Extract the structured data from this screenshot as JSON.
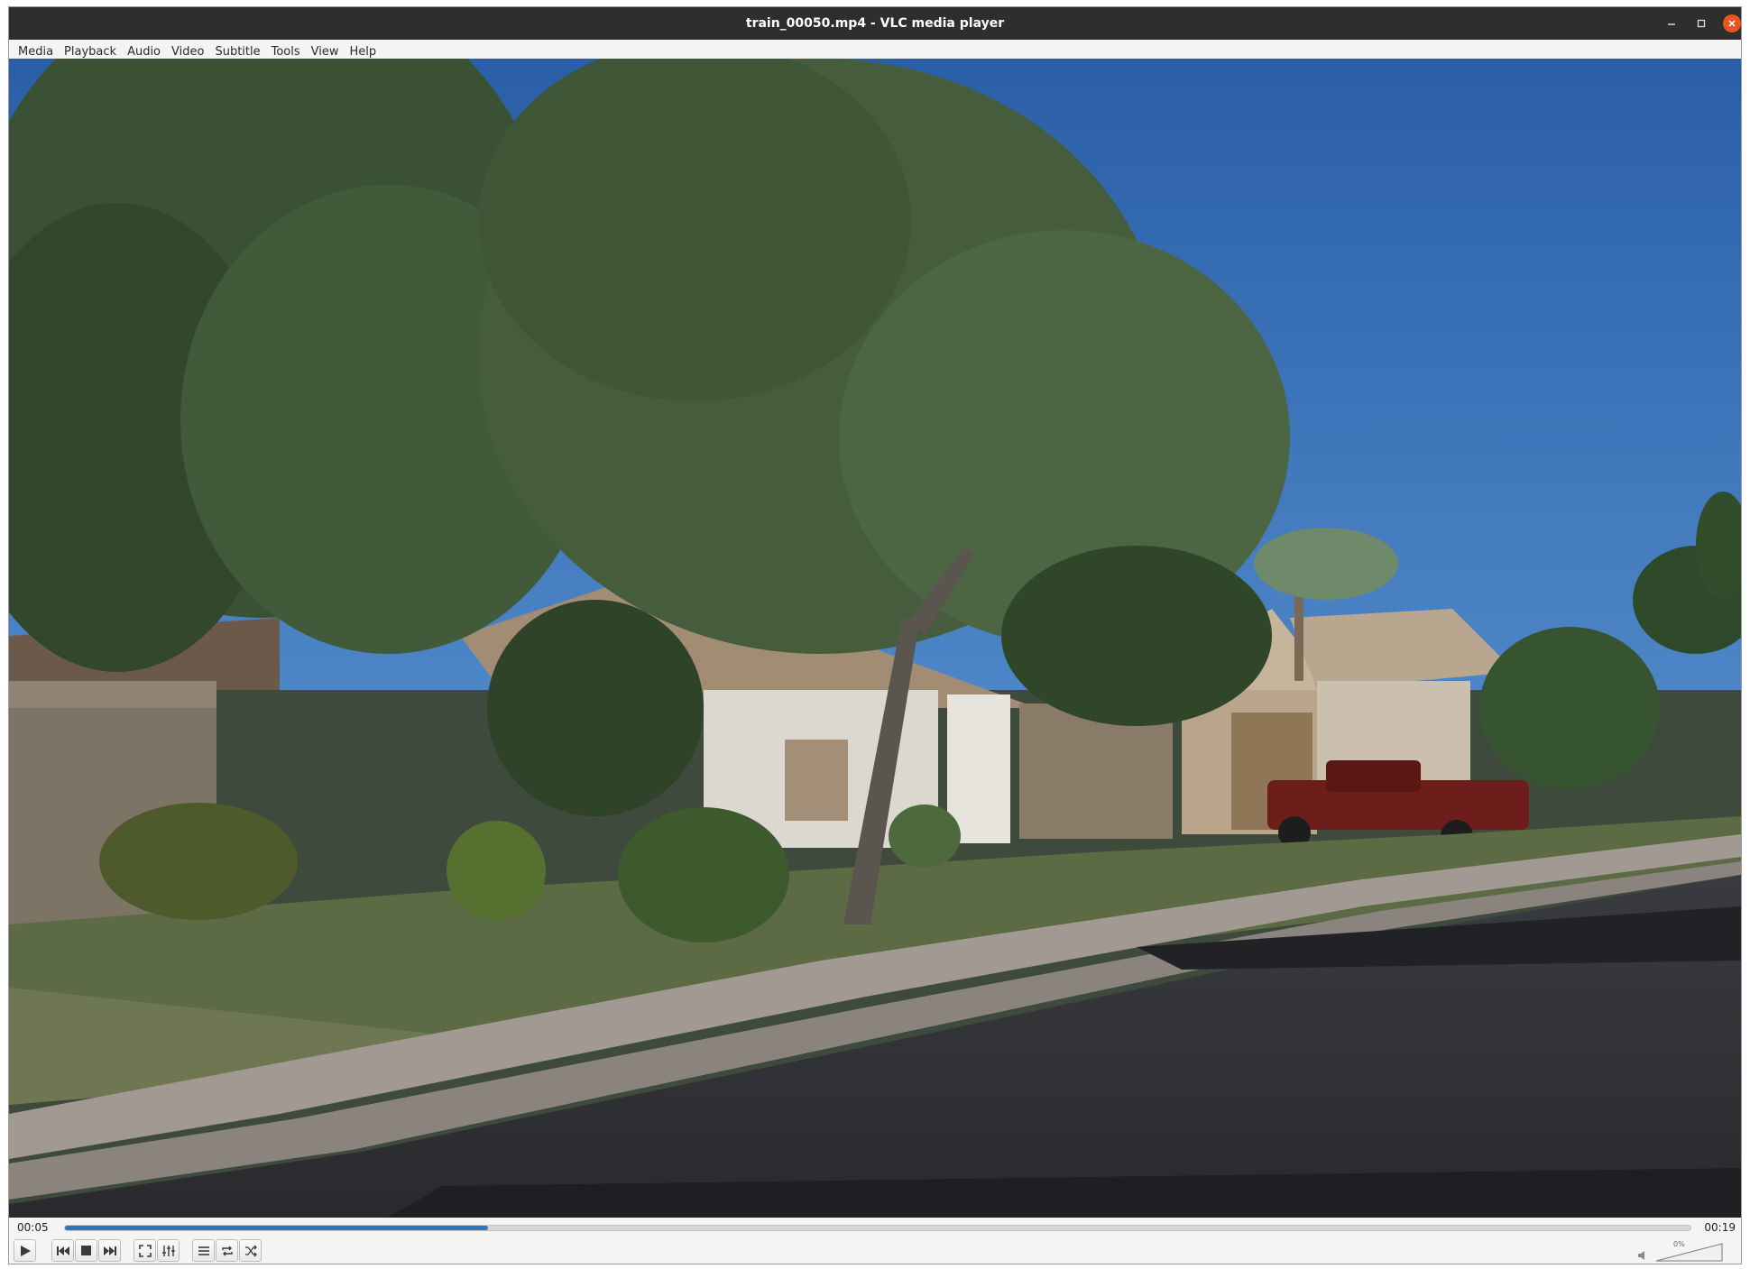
{
  "window": {
    "title": "train_00050.mp4 - VLC media player"
  },
  "menu": [
    "Media",
    "Playback",
    "Audio",
    "Video",
    "Subtitle",
    "Tools",
    "View",
    "Help"
  ],
  "player": {
    "time_elapsed": "00:05",
    "time_total": "00:19",
    "progress_fraction": 0.26,
    "volume_text": "0%",
    "volume_fraction": 0.0
  },
  "icons": {
    "minimize": "minimize-icon",
    "maximize": "maximize-icon",
    "close": "close-icon",
    "play": "play-icon",
    "previous": "skip-previous-icon",
    "stop": "stop-icon",
    "next": "skip-next-icon",
    "fullscreen": "fullscreen-icon",
    "extended_settings": "equalizer-icon",
    "playlist": "playlist-icon",
    "loop": "loop-icon",
    "shuffle": "shuffle-icon",
    "volume": "speaker-muted-icon"
  },
  "colors": {
    "titlebar": "#2e2e2e",
    "close_button": "#e95420",
    "seek_fill": "#2f76c2",
    "sky": "#2c63ad"
  }
}
